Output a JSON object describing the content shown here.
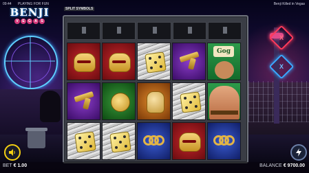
{
  "status": {
    "time": "09:44",
    "mode": "PLAYING FOR FUN",
    "game_title": "Benji Killed in Vegas"
  },
  "logo": {
    "main": "BENJI",
    "sub_letters": [
      "V",
      "E",
      "G",
      "A",
      "S"
    ]
  },
  "frame_label": "SPLIT SYMBOLS",
  "reels": [
    [
      {
        "symbol": "teeth-icon",
        "bg": "red"
      },
      {
        "symbol": "gun-icon",
        "bg": "purple"
      },
      {
        "symbol": "dice-icon",
        "bg": "news"
      }
    ],
    [
      {
        "symbol": "teeth-icon",
        "bg": "red"
      },
      {
        "symbol": "coin-icon",
        "bg": "green"
      },
      {
        "symbol": "dice-icon",
        "bg": "news"
      }
    ],
    [
      {
        "symbol": "dice-icon",
        "bg": "news"
      },
      {
        "symbol": "glove-icon",
        "bg": "orange"
      },
      {
        "symbol": "knuckles-icon",
        "bg": "blue"
      }
    ],
    [
      {
        "symbol": "gun-icon",
        "bg": "purple"
      },
      {
        "symbol": "dice-icon",
        "bg": "news"
      },
      {
        "symbol": "teeth-icon",
        "bg": "red"
      }
    ],
    [
      {
        "symbol": "wild-icon",
        "bg": "wild"
      },
      {
        "symbol": "wild-icon",
        "bg": "wild"
      },
      {
        "symbol": "knuckles-icon",
        "bg": "blue"
      }
    ]
  ],
  "wild_label": "Gog",
  "news_label": "",
  "feature_buttons": [
    {
      "icon": "x-feature-icon",
      "label": "X",
      "color": "#ff3a5a"
    },
    {
      "icon": "2x-feature-icon",
      "label": "X",
      "color": "#3aa8ff"
    }
  ],
  "bet": {
    "label": "BET",
    "value": "€ 1.00"
  },
  "balance": {
    "label": "BALANCE",
    "value": "€ 9700.00"
  },
  "icons": {
    "sound": "speaker-icon",
    "spin": "lightning-icon"
  },
  "colors": {
    "accent": "#f5d012",
    "feature_red": "#ff3a5a",
    "feature_blue": "#3aa8ff"
  }
}
